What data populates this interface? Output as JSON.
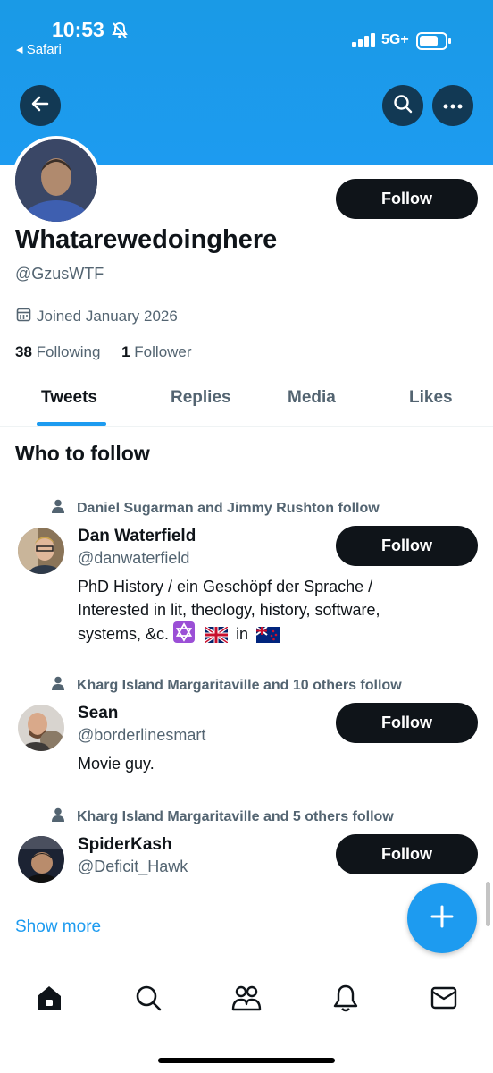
{
  "status_bar": {
    "time": "10:53",
    "back_app": "◂ Safari",
    "network": "5G+"
  },
  "header": {
    "back_icon": "arrow-left-icon",
    "search_icon": "search-icon",
    "more_icon": "more-horizontal-icon"
  },
  "profile": {
    "name": "Whatarewedoinghere",
    "handle": "@GzusWTF",
    "joined": "Joined January 2026",
    "following_count": "38",
    "following_label": "Following",
    "followers_count": "1",
    "followers_label": "Follower",
    "follow_label": "Follow"
  },
  "tabs": [
    "Tweets",
    "Replies",
    "Media",
    "Likes"
  ],
  "who_to_follow": {
    "title": "Who to follow",
    "users": [
      {
        "social_context": "Daniel Sugarman and Jimmy Rushton follow",
        "name": "Dan Waterfield",
        "handle": "@danwaterfield",
        "bio_lines": [
          "PhD History / ein Geschöpf der Sprache /",
          "Interested in lit, theology, history, software,",
          "systems, &c."
        ],
        "bio_in": "in",
        "follow_label": "Follow"
      },
      {
        "social_context": "Kharg Island Margaritaville and 10 others follow",
        "name": "Sean",
        "handle": "@borderlinesmart",
        "bio_lines": [
          "Movie guy."
        ],
        "follow_label": "Follow"
      },
      {
        "social_context": "Kharg Island Margaritaville and 5 others follow",
        "name": "SpiderKash",
        "handle": "@Deficit_Hawk",
        "follow_label": "Follow"
      }
    ],
    "show_more": "Show more"
  },
  "colors": {
    "accent": "#1d9bf0",
    "text": "#0f1419",
    "secondary": "#536471",
    "button": "#0f1419"
  }
}
